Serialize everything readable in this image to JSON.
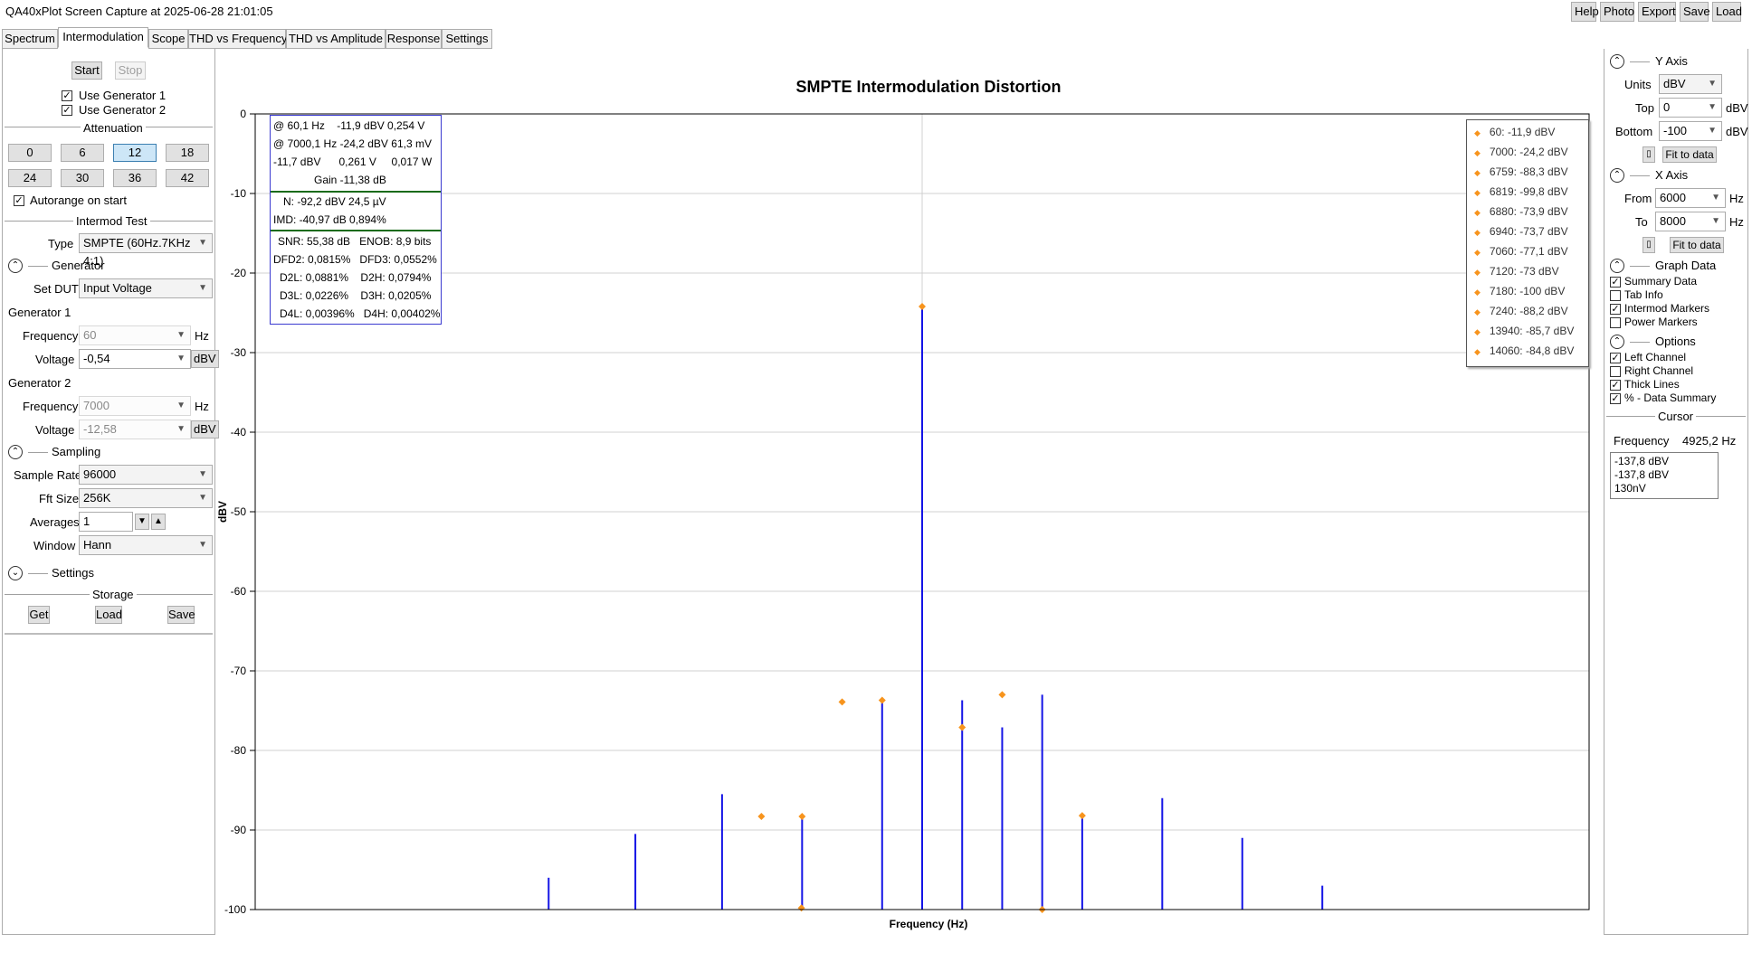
{
  "window": {
    "title": "QA40xPlot Screen Capture at 2025-06-28 21:01:05",
    "buttons": [
      "Help",
      "Photo",
      "Export",
      "Save",
      "Load"
    ]
  },
  "tabs": [
    "Spectrum",
    "Intermodulation",
    "Scope",
    "THD vs Frequency",
    "THD vs Amplitude",
    "Response",
    "Settings"
  ],
  "left": {
    "start": "Start",
    "stop": "Stop",
    "use_gen1": "Use Generator 1",
    "use_gen2": "Use Generator 2",
    "attenuation_header": "Attenuation",
    "attenuation": [
      "0",
      "6",
      "12",
      "18",
      "24",
      "30",
      "36",
      "42"
    ],
    "autorange": "Autorange on start",
    "intermod_header": "Intermod Test",
    "type_label": "Type",
    "type_value": "SMPTE (60Hz.7KHz 4:1)",
    "generator_header": "Generator",
    "set_dut_label": "Set DUT",
    "set_dut_value": "Input Voltage",
    "gen1_label": "Generator 1",
    "gen1_freq_label": "Frequency",
    "gen1_freq_value": "60",
    "gen1_freq_unit": "Hz",
    "gen1_volt_label": "Voltage",
    "gen1_volt_value": "-0,54",
    "gen1_volt_unit": "dBV",
    "gen2_label": "Generator 2",
    "gen2_freq_label": "Frequency",
    "gen2_freq_value": "7000",
    "gen2_freq_unit": "Hz",
    "gen2_volt_label": "Voltage",
    "gen2_volt_value": "-12,58",
    "gen2_volt_unit": "dBV",
    "sampling_header": "Sampling",
    "sample_rate_label": "Sample Rate",
    "sample_rate_value": "96000",
    "fft_label": "Fft Size",
    "fft_value": "256K",
    "averages_label": "Averages",
    "averages_value": "1",
    "window_label": "Window",
    "window_value": "Hann",
    "settings_header": "Settings",
    "storage_header": "Storage",
    "get": "Get",
    "load": "Load",
    "save": "Save"
  },
  "summary": {
    "rows": [
      [
        "@ 60,1 Hz",
        "-11,9 dBV 0,254 V"
      ],
      [
        "@ 7000,1 Hz",
        "-24,2 dBV 61,3 mV"
      ],
      [
        "-11,7 dBV",
        "0,261 V",
        "0,017 W"
      ],
      [
        "Gain -11,38 dB"
      ],
      [
        "N: -92,2 dBV 24,5 µV"
      ],
      [
        "IMD: -40,97 dB 0,894%"
      ],
      [
        "SNR: 55,38 dB",
        "ENOB: 8,9 bits"
      ],
      [
        "DFD2: 0,0815%",
        "DFD3: 0,0552%"
      ],
      [
        "D2L: 0,0881%",
        "D2H: 0,0794%"
      ],
      [
        "D3L: 0,0226%",
        "D3H: 0,0205%"
      ],
      [
        "D4L: 0,00396%",
        "D4H: 0,00402%"
      ]
    ]
  },
  "markers_legend": [
    "60: -11,9 dBV",
    "7000: -24,2 dBV",
    "6759: -88,3 dBV",
    "6819: -99,8 dBV",
    "6880: -73,9 dBV",
    "6940: -73,7 dBV",
    "7060: -77,1 dBV",
    "7120: -73 dBV",
    "7180: -100 dBV",
    "7240: -88,2 dBV",
    "13940: -85,7 dBV",
    "14060: -84,8 dBV"
  ],
  "chart_data": {
    "type": "bar",
    "title": "SMPTE  Intermodulation Distortion",
    "xlabel": "Frequency (Hz)",
    "ylabel": "dBV",
    "xlim": [
      6000,
      8000
    ],
    "ylim": [
      -100,
      0
    ],
    "yticks": [
      0,
      -10,
      -20,
      -30,
      -40,
      -50,
      -60,
      -70,
      -80,
      -90,
      -100
    ],
    "grid": true,
    "legend": "top-right",
    "spectrum": {
      "x": [
        6440,
        6570,
        6700,
        6820,
        6940,
        7000,
        7060,
        7120,
        7180,
        7240,
        7360,
        7480,
        7600
      ],
      "y": [
        -96,
        -90.5,
        -85.5,
        -88.3,
        -73.9,
        -24.2,
        -73.7,
        -77.1,
        -73,
        -88.2,
        -86,
        -91,
        -97
      ]
    },
    "markers": {
      "x": [
        6820,
        6880,
        6940,
        7000,
        7060,
        7120,
        7180,
        7240,
        6759,
        6819
      ],
      "y": [
        -88.3,
        -73.9,
        -73.7,
        -24.2,
        -77.1,
        -73,
        -100,
        -88.2,
        -88.3,
        -99.8
      ]
    },
    "colors": {
      "trace": "#1414e6",
      "marker": "#f7941d"
    }
  },
  "right": {
    "yaxis_header": "Y Axis",
    "units_label": "Units",
    "units_value": "dBV",
    "top_label": "Top",
    "top_value": "0",
    "top_unit": "dBV",
    "bottom_label": "Bottom",
    "bottom_value": "-100",
    "bottom_unit": "dBV",
    "fit_y": "Fit to data",
    "xaxis_header": "X Axis",
    "from_label": "From",
    "from_value": "6000",
    "from_unit": "Hz",
    "to_label": "To",
    "to_value": "8000",
    "to_unit": "Hz",
    "fit_x": "Fit to data",
    "graph_data_header": "Graph Data",
    "summary_data": "Summary Data",
    "tab_info": "Tab Info",
    "intermod_markers": "Intermod Markers",
    "power_markers": "Power Markers",
    "options_header": "Options",
    "left_channel": "Left Channel",
    "right_channel": "Right Channel",
    "thick_lines": "Thick Lines",
    "pct_summary": "% - Data Summary",
    "cursor_header": "Cursor",
    "cursor_freq_label": "Frequency",
    "cursor_freq_value": "4925,2 Hz",
    "cursor_values": [
      "-137,8 dBV",
      "-137,8 dBV",
      "130nV"
    ]
  }
}
